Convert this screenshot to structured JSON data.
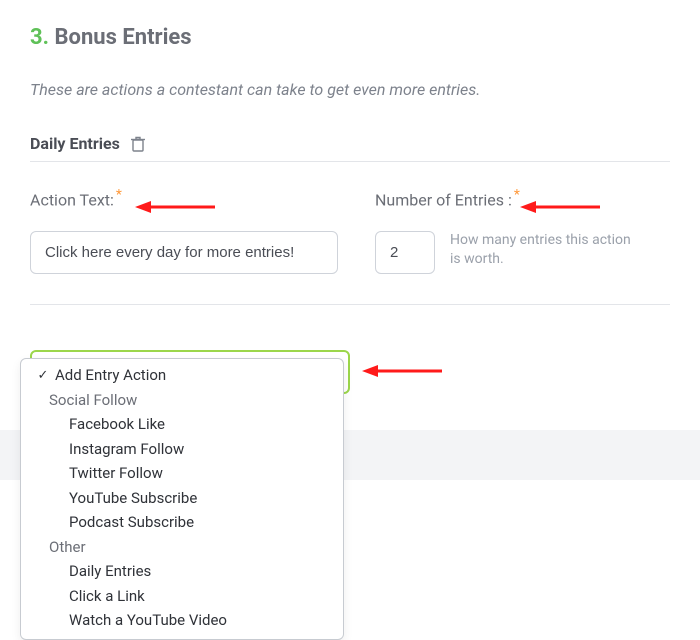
{
  "heading": {
    "number": "3.",
    "title": "Bonus Entries"
  },
  "helper": "These are actions a contestant can take to get even more entries.",
  "subheading": "Daily Entries",
  "fields": {
    "action_text": {
      "label": "Action Text:",
      "value": "Click here every day for more entries!"
    },
    "num_entries": {
      "label": "Number of Entries :",
      "value": "2",
      "hint": "How many entries this action is worth."
    }
  },
  "dropdown": {
    "selected": "Add Entry Action",
    "groups": [
      {
        "label": "Social Follow",
        "items": [
          "Facebook Like",
          "Instagram Follow",
          "Twitter Follow",
          "YouTube Subscribe",
          "Podcast Subscribe"
        ]
      },
      {
        "label": "Other",
        "items": [
          "Daily Entries",
          "Click a Link",
          "Watch a YouTube Video"
        ]
      }
    ]
  }
}
